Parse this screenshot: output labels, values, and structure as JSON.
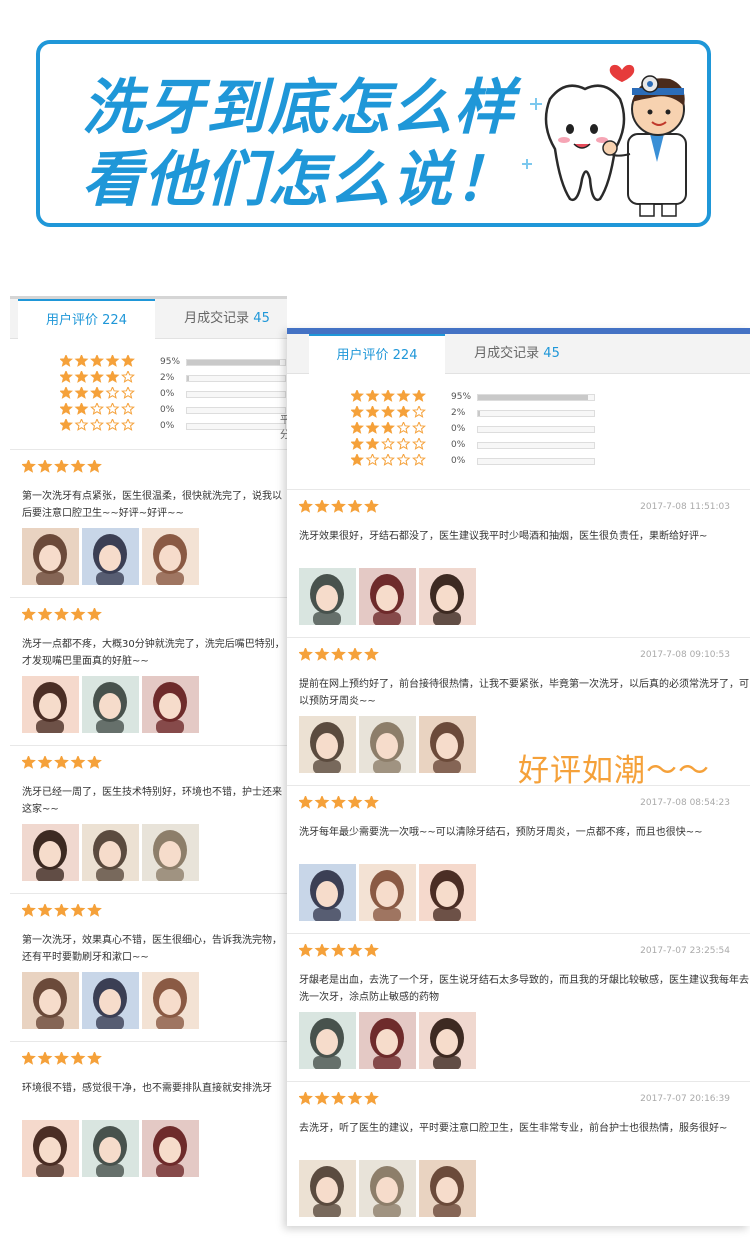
{
  "banner": {
    "line1": "洗牙到底怎么样",
    "line2": "看他们怎么说！"
  },
  "overlay": {
    "text": "好评如潮～～"
  },
  "colors": {
    "accent": "#1f97d8",
    "star": "#f5a13a",
    "frame_blue": "#4472c4"
  },
  "back_panel": {
    "tabs": [
      {
        "label": "用户评价 ",
        "count": "224"
      },
      {
        "label": "月成交记录 ",
        "count": "45"
      }
    ],
    "distribution": [
      {
        "stars": 5,
        "pct": "95%",
        "fraction": 0.95
      },
      {
        "stars": 4,
        "pct": "2%",
        "fraction": 0.02
      },
      {
        "stars": 3,
        "pct": "0%",
        "fraction": 0
      },
      {
        "stars": 2,
        "pct": "0%",
        "fraction": 0
      },
      {
        "stars": 1,
        "pct": "0%",
        "fraction": 0
      }
    ],
    "edge_text": "平分",
    "reviews": [
      {
        "text": "第一次洗牙有点紧张，医生很温柔，很快就洗完了，说我以后要注意口腔卫生~~好评~好评~~"
      },
      {
        "text": "洗牙一点都不疼，大概30分钟就洗完了，洗完后嘴巴特别，才发现嘴巴里面真的好脏~~"
      },
      {
        "text": "洗牙已经一周了，医生技术特别好，环境也不错，护士还来这家~~"
      },
      {
        "text": "第一次洗牙，效果真心不错，医生很细心，告诉我洗完物，还有平时要勤刷牙和漱口~~"
      },
      {
        "text": "环境很不错，感觉很干净，也不需要排队直接就安排洗牙"
      }
    ]
  },
  "front_panel": {
    "tabs": [
      {
        "label": "用户评价 ",
        "count": "224"
      },
      {
        "label": "月成交记录 ",
        "count": "45"
      }
    ],
    "distribution": [
      {
        "stars": 5,
        "pct": "95%",
        "fraction": 0.95
      },
      {
        "stars": 4,
        "pct": "2%",
        "fraction": 0.02
      },
      {
        "stars": 3,
        "pct": "0%",
        "fraction": 0
      },
      {
        "stars": 2,
        "pct": "0%",
        "fraction": 0
      },
      {
        "stars": 1,
        "pct": "0%",
        "fraction": 0
      }
    ],
    "reviews": [
      {
        "date": "2017-7-08 11:51:03",
        "text": "洗牙效果很好，牙结石都没了，医生建议我平时少喝酒和抽烟，医生很负责任，果断给好评~"
      },
      {
        "date": "2017-7-08 09:10:53",
        "text": "提前在网上预约好了，前台接待很热情，让我不要紧张，毕竟第一次洗牙，以后真的必须常洗牙了，可以预防牙周炎~~"
      },
      {
        "date": "2017-7-08 08:54:23",
        "text": "洗牙每年最少需要洗一次哦~~可以清除牙结石，预防牙周炎，一点都不疼，而且也很快~~"
      },
      {
        "date": "2017-7-07 23:25:54",
        "text": "牙龈老是出血，去洗了一个牙，医生说牙结石太多导致的，而且我的牙龈比较敏感，医生建议我每年去洗一次牙，涂点防止敏感的药物"
      },
      {
        "date": "2017-7-07 20:16:39",
        "text": "去洗牙，听了医生的建议，平时要注意口腔卫生，医生非常专业，前台护士也很热情，服务很好~"
      }
    ]
  }
}
